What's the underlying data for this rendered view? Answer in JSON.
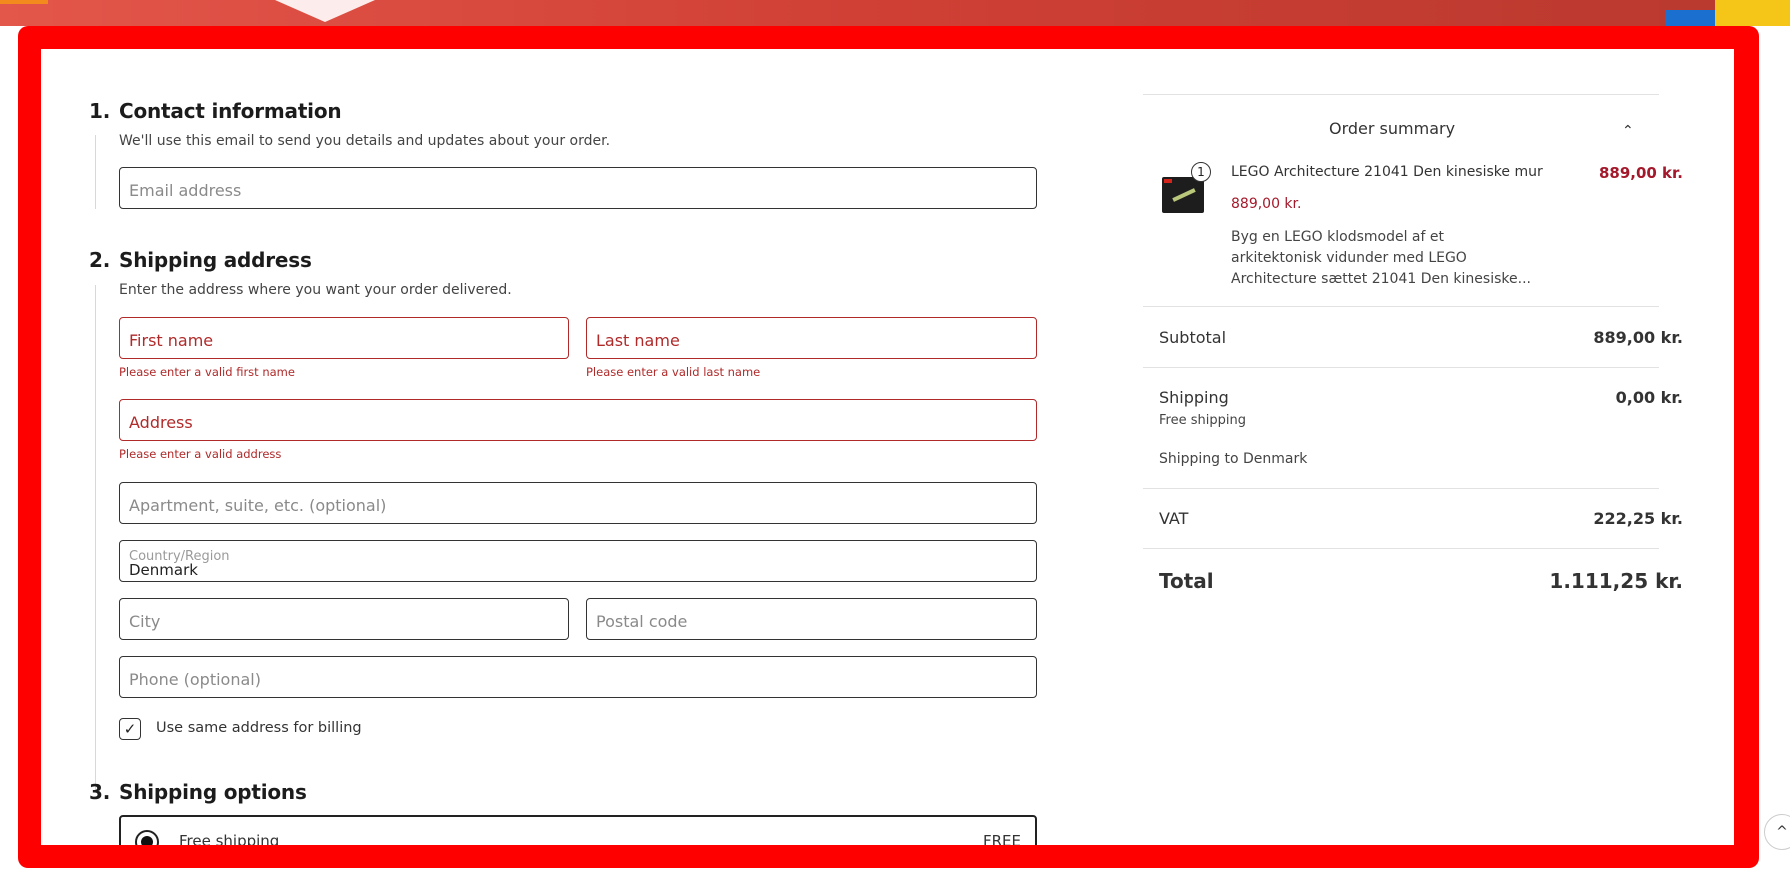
{
  "contact": {
    "number": "1.",
    "title": "Contact information",
    "helper": "We'll use this email to send you details and updates about your order.",
    "email_placeholder": "Email address"
  },
  "shipping_address": {
    "number": "2.",
    "title": "Shipping address",
    "helper": "Enter the address where you want your order delivered.",
    "first_name_placeholder": "First name",
    "first_name_error": "Please enter a valid first name",
    "last_name_placeholder": "Last name",
    "last_name_error": "Please enter a valid last name",
    "address_placeholder": "Address",
    "address_error": "Please enter a valid address",
    "apartment_placeholder": "Apartment, suite, etc. (optional)",
    "country_label": "Country/Region",
    "country_value": "Denmark",
    "city_placeholder": "City",
    "postal_placeholder": "Postal code",
    "phone_placeholder": "Phone (optional)",
    "same_billing_label": "Use same address for billing",
    "same_billing_checked": true,
    "check_glyph": "✓"
  },
  "shipping_options": {
    "number": "3.",
    "title": "Shipping options",
    "option_label": "Free shipping",
    "option_price": "FREE"
  },
  "summary": {
    "title": "Order summary",
    "chevron": "⌃",
    "item": {
      "qty": "1",
      "name": "LEGO Architecture 21041 Den kinesiske mur",
      "unit_price": "889,00 kr.",
      "line_total": "889,00 kr.",
      "description": "Byg en LEGO klodsmodel af et arkitektonisk vidunder med LEGO Architecture sættet 21041 Den kinesiske..."
    },
    "subtotal_label": "Subtotal",
    "subtotal_value": "889,00 kr.",
    "shipping_label": "Shipping",
    "shipping_value": "0,00 kr.",
    "shipping_method": "Free shipping",
    "shipping_to": "Shipping to Denmark",
    "vat_label": "VAT",
    "vat_value": "222,25 kr.",
    "total_label": "Total",
    "total_value": "1.111,25 kr."
  },
  "scroll_top_glyph": "^",
  "colors": {
    "frame": "#ff0000",
    "error": "#b02a2a",
    "price": "#a3192b"
  }
}
